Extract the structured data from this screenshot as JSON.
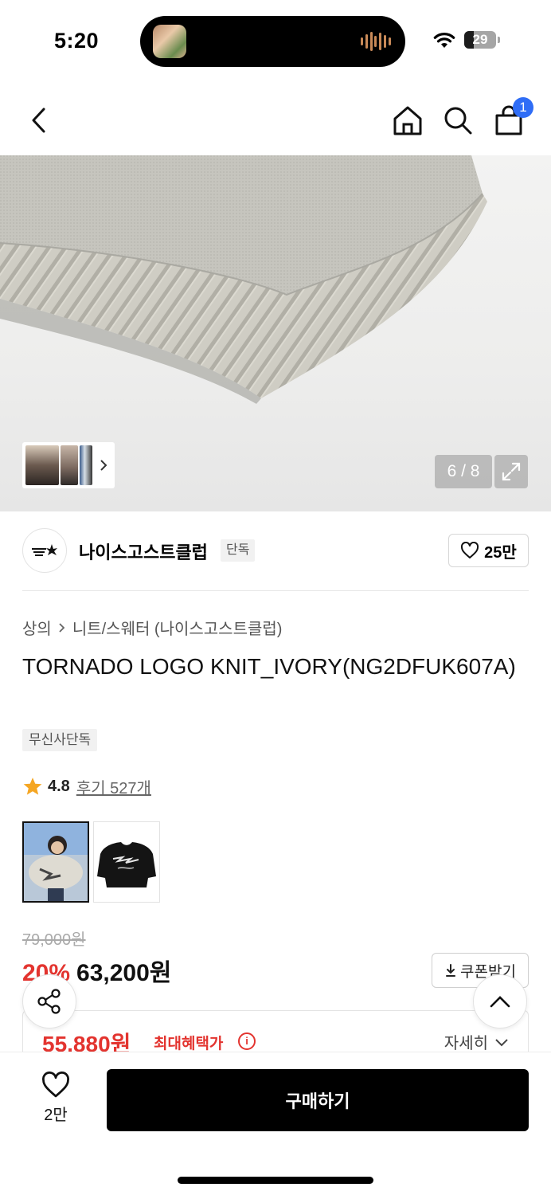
{
  "status_bar": {
    "time": "5:20",
    "battery_percent": "29",
    "battery_level": 0.29
  },
  "nav": {
    "back_icon": "chevron-left-icon",
    "home_icon": "home-icon",
    "search_icon": "search-icon",
    "cart_icon": "shopping-bag-icon",
    "cart_count": "1"
  },
  "gallery": {
    "counter": "6 / 8",
    "expand_icon": "expand-icon"
  },
  "brand": {
    "name": "나이스고스트클럽",
    "tag": "단독",
    "likes": "25만"
  },
  "breadcrumb": {
    "category": "상의",
    "subcategory": "니트/스웨터 (나이스고스트클럽)"
  },
  "product": {
    "title": "TORNADO LOGO KNIT_IVORY(NG2DFUK607A)",
    "tag": "무신사단독",
    "rating": "4.8",
    "reviews": "후기 527개",
    "original_price": "79,000원",
    "discount": "20%",
    "price": "63,200원",
    "coupon_label": "쿠폰받기",
    "best_price": "55,880원",
    "best_price_label": "최대혜택가",
    "detail_label": "자세히"
  },
  "bottom_bar": {
    "wish_count": "2만",
    "buy_label": "구매하기"
  },
  "colors": {
    "accent_red": "#e3342f",
    "badge_blue": "#2f6df6",
    "star": "#f5a623"
  }
}
